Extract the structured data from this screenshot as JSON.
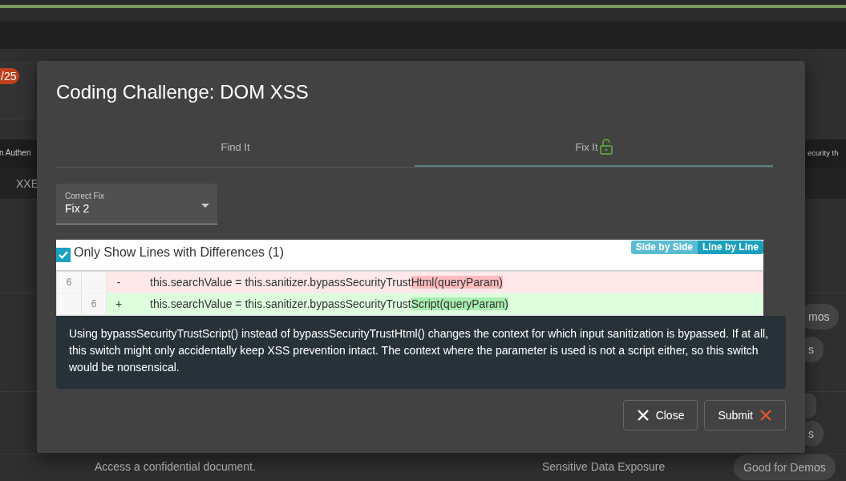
{
  "background": {
    "score_badge": "/25",
    "left_texts": [
      "n Authen",
      "XXE"
    ],
    "right_text": "ecurity th",
    "pills": [
      "mos",
      "s",
      "s"
    ],
    "row": {
      "description": "Access a confidential document.",
      "category": "Sensitive Data Exposure",
      "tag": "Good for Demos"
    }
  },
  "dialog": {
    "title": "Coding Challenge: DOM XSS",
    "tabs": [
      {
        "label": "Find It",
        "selected": false,
        "unlocked": false
      },
      {
        "label": "Fix It",
        "selected": true,
        "unlocked": true
      }
    ],
    "select": {
      "label": "Correct Fix",
      "value": "Fix 2"
    },
    "diff": {
      "only_differences": {
        "label": "Only Show Lines with Differences (1)",
        "checked": true
      },
      "views": [
        {
          "label": "Side by Side",
          "selected": false
        },
        {
          "label": "Line by Line",
          "selected": true
        }
      ],
      "lines": [
        {
          "kind": "removed",
          "old": "6",
          "sign": "-",
          "segments": [
            {
              "text": "this.searchValue = this.sanitizer.bypassSecurityTrust",
              "changed": false
            },
            {
              "text": "Html(queryParam",
              "changed": true
            },
            {
              "text": ")",
              "changed": true
            }
          ]
        },
        {
          "kind": "added",
          "new": "6",
          "sign": "+",
          "segments": [
            {
              "text": "this.searchValue = this.sanitizer.bypassSecurityTrust",
              "changed": false
            },
            {
              "text": "Script(queryPa",
              "changed": true
            },
            {
              "text": "ram)",
              "changed": true
            }
          ]
        }
      ]
    },
    "explanation": "Using bypassSecurityTrustScript() instead of bypassSecurityTrustHtml() changes the context for which input sanitization is bypassed. If at all, this switch might only accidentally keep XSS prevention intact. The context where the parameter is used is not a script either, so this switch would be nonsensical.",
    "buttons": [
      {
        "label": "Close",
        "kind": "close"
      },
      {
        "label": "Submit",
        "kind": "submit"
      }
    ]
  }
}
